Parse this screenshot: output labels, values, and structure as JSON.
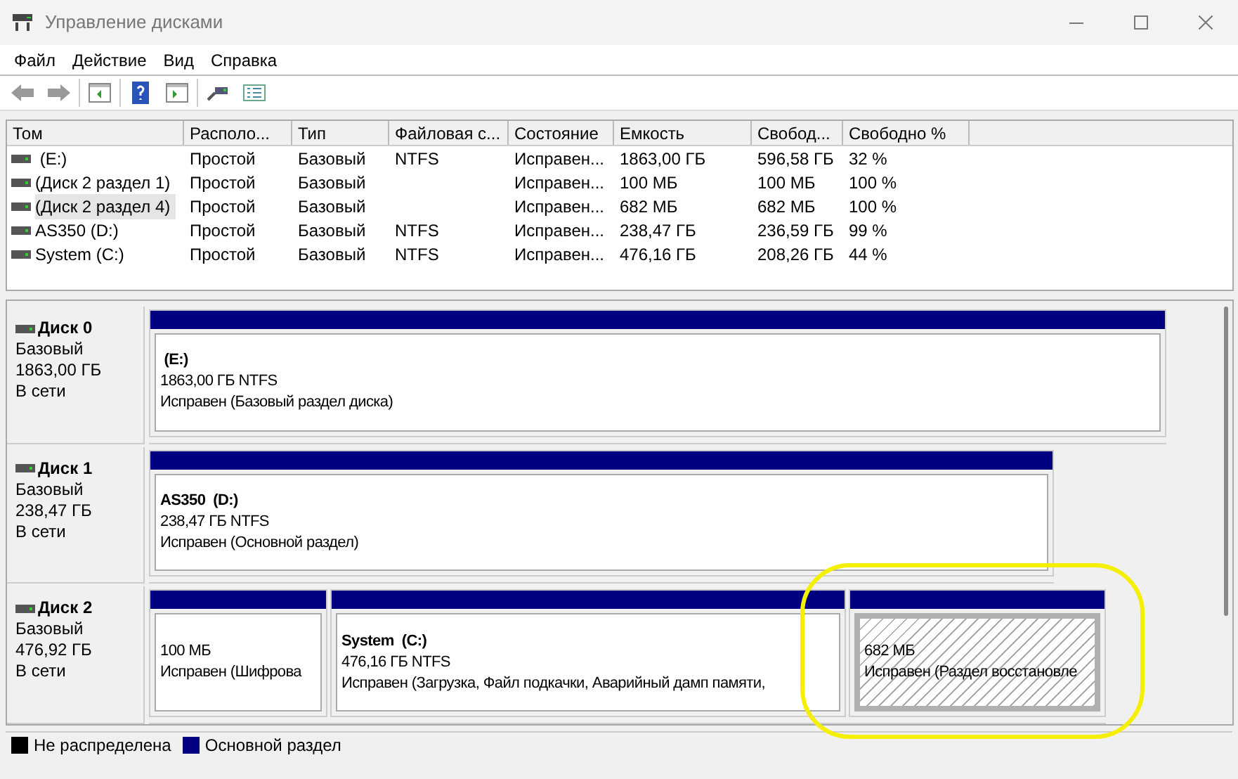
{
  "window": {
    "title": "Управление дисками"
  },
  "menu": [
    "Файл",
    "Действие",
    "Вид",
    "Справка"
  ],
  "table": {
    "columns": [
      "Том",
      "Располо...",
      "Тип",
      "Файловая с...",
      "Состояние",
      "Емкость",
      "Свобод...",
      "Свободно %"
    ],
    "rows": [
      {
        "cells": [
          " (E:)",
          "Простой",
          "Базовый",
          "NTFS",
          "Исправен...",
          "1863,00 ГБ",
          "596,58 ГБ",
          "32 %"
        ],
        "selected": false
      },
      {
        "cells": [
          "(Диск 2 раздел 1)",
          "Простой",
          "Базовый",
          "",
          "Исправен...",
          "100 МБ",
          "100 МБ",
          "100 %"
        ],
        "selected": false
      },
      {
        "cells": [
          "(Диск 2 раздел 4)",
          "Простой",
          "Базовый",
          "",
          "Исправен...",
          "682 МБ",
          "682 МБ",
          "100 %"
        ],
        "selected": true
      },
      {
        "cells": [
          "AS350 (D:)",
          "Простой",
          "Базовый",
          "NTFS",
          "Исправен...",
          "238,47 ГБ",
          "236,59 ГБ",
          "99 %"
        ],
        "selected": false
      },
      {
        "cells": [
          "System (C:)",
          "Простой",
          "Базовый",
          "NTFS",
          "Исправен...",
          "476,16 ГБ",
          "208,26 ГБ",
          "44 %"
        ],
        "selected": false
      }
    ]
  },
  "disks": [
    {
      "name": "Диск 0",
      "type": "Базовый",
      "size": "1863,00 ГБ",
      "status": "В сети",
      "partitions": [
        {
          "label": " (E:)",
          "size": "1863,00 ГБ NTFS",
          "status": "Исправен (Базовый раздел диска)",
          "selected": false
        }
      ]
    },
    {
      "name": "Диск 1",
      "type": "Базовый",
      "size": "238,47 ГБ",
      "status": "В сети",
      "partitions": [
        {
          "label": "AS350  (D:)",
          "size": "238,47 ГБ NTFS",
          "status": "Исправен (Основной раздел)",
          "selected": false
        }
      ]
    },
    {
      "name": "Диск 2",
      "type": "Базовый",
      "size": "476,92 ГБ",
      "status": "В сети",
      "partitions": [
        {
          "size": "100 МБ",
          "status": "Исправен (Шифрова",
          "selected": false
        },
        {
          "label": "System  (C:)",
          "size": "476,16 ГБ NTFS",
          "status": "Исправен (Загрузка, Файл подкачки, Аварийный дамп памяти, ",
          "selected": false
        },
        {
          "size": "682 МБ",
          "status": "Исправен (Раздел восстановле",
          "selected": true
        }
      ]
    }
  ],
  "legend": [
    {
      "label": "Не распределена",
      "color": "#000000"
    },
    {
      "label": "Основной раздел",
      "color": "#000080"
    }
  ]
}
